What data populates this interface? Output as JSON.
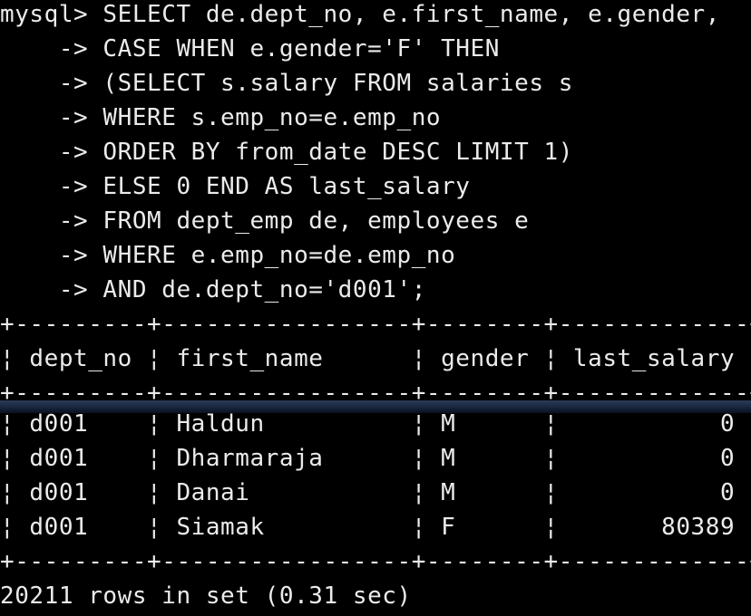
{
  "terminal": {
    "query_lines": [
      "mysql> SELECT de.dept_no, e.first_name, e.gender,",
      "    -> CASE WHEN e.gender='F' THEN",
      "    -> (SELECT s.salary FROM salaries s",
      "    -> WHERE s.emp_no=e.emp_no",
      "    -> ORDER BY from_date DESC LIMIT 1)",
      "    -> ELSE 0 END AS last_salary",
      "    -> FROM dept_emp de, employees e",
      "    -> WHERE e.emp_no=de.emp_no",
      "    -> AND de.dept_no='d001';"
    ],
    "table": {
      "border_top": "+---------+-----------------+--------+-------------+",
      "header_row": "¦ dept_no ¦ first_name      ¦ gender ¦ last_salary ¦",
      "header_separator": "+---------+-----------------+--------+-------------+",
      "rows": [
        "¦ d001    ¦ Haldun          ¦ M      ¦           0 ¦",
        "¦ d001    ¦ Dharmaraja      ¦ M      ¦           0 ¦",
        "¦ d001    ¦ Danai           ¦ M      ¦           0 ¦",
        "¦ d001    ¦ Siamak          ¦ F      ¦       80389 ¦"
      ],
      "border_bottom": "+---------+-----------------+--------+-------------+"
    },
    "result_summary": "20211 rows in set (0.31 sec)"
  }
}
